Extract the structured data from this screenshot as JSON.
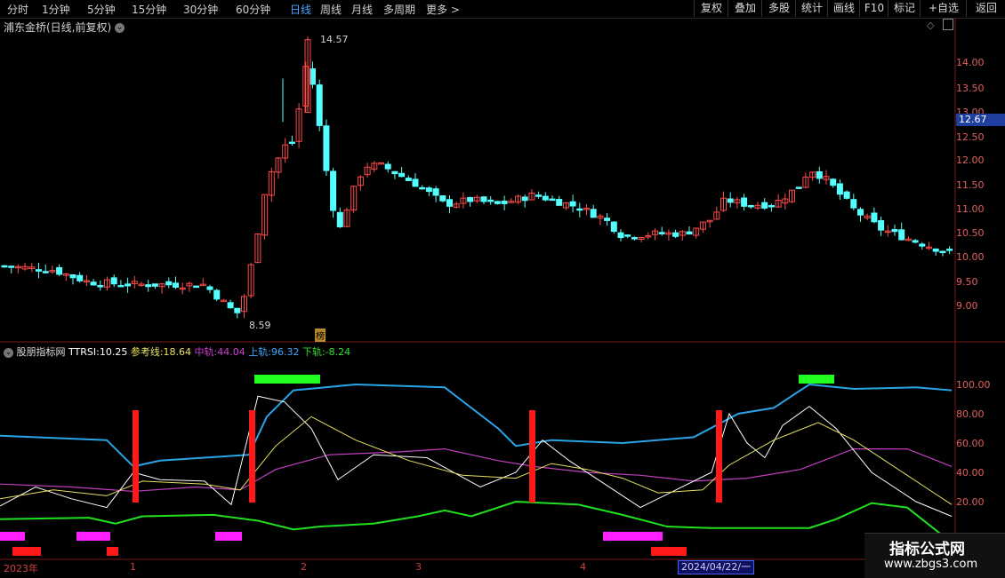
{
  "toolbar": {
    "periods": [
      "分时",
      "1分钟",
      "5分钟",
      "15分钟",
      "30分钟",
      "60分钟",
      "日线",
      "周线",
      "月线",
      "多周期",
      "更多 >"
    ],
    "active_period": "日线",
    "buttons": [
      "复权",
      "叠加",
      "多股",
      "统计",
      "画线",
      "F10",
      "标记",
      "+自选",
      "返回"
    ]
  },
  "main_chart": {
    "title": "浦东金桥(日线,前复权)",
    "price_axis": [
      "14.00",
      "13.50",
      "13.00",
      "12.50",
      "12.00",
      "11.50",
      "11.00",
      "10.50",
      "10.00",
      "9.50",
      "9.00"
    ],
    "current_price": "12.67",
    "high_label": "14.57",
    "low_label": "8.59",
    "tag": "榜"
  },
  "indicator": {
    "name": "股朋指标网",
    "values": [
      {
        "label": "TTRSI:",
        "value": "10.25",
        "color": "#ffffff"
      },
      {
        "label": "参考线:",
        "value": "18.64",
        "color": "#e8e060"
      },
      {
        "label": "中轨:",
        "value": "44.04",
        "color": "#d040d0"
      },
      {
        "label": "上轨:",
        "value": "96.32",
        "color": "#40a8ff"
      },
      {
        "label": "下轨:",
        "value": "-8.24",
        "color": "#30e030"
      }
    ],
    "axis": [
      "100.00",
      "80.00",
      "60.00",
      "40.00",
      "20.00"
    ]
  },
  "dates": {
    "year": "2023年",
    "months": [
      "1",
      "2",
      "3",
      "4"
    ],
    "cursor": "2024/04/22/一"
  },
  "watermark": {
    "name": "指标公式网",
    "url": "www.zbgs3.com"
  },
  "colors": {
    "up": "#ff4a4a",
    "down": "#54ffff",
    "upper": "#2aa4e8",
    "mid": "#c040c0",
    "lower": "#20e020",
    "tt": "#ffffff",
    "ref": "#e8e060"
  }
}
